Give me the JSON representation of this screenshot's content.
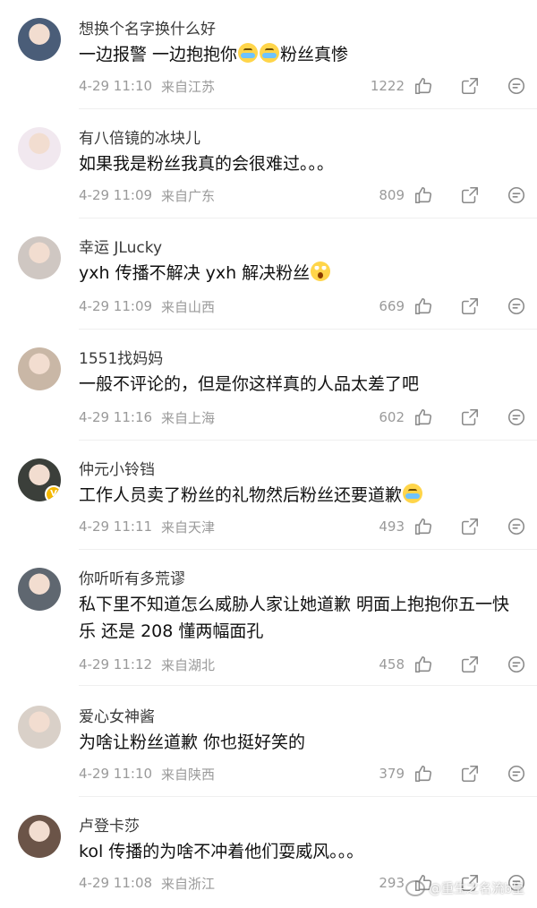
{
  "comments": [
    {
      "username": "想换个名字换什么好",
      "text_parts": [
        "一边报警 一边抱抱你",
        "",
        "粉丝真惨"
      ],
      "emojis": [
        "cry",
        "cry"
      ],
      "date": "4-29 11:10",
      "location": "来自江苏",
      "likes": "1222",
      "avatar_color": "#4a5d78"
    },
    {
      "username": "有八倍镜的冰块儿",
      "text_parts": [
        "如果我是粉丝我真的会很难过。。。"
      ],
      "emojis": [],
      "date": "4-29 11:09",
      "location": "来自广东",
      "likes": "809",
      "avatar_color": "#f1e8ef"
    },
    {
      "username": "幸运 JLucky",
      "text_parts": [
        "yxh 传播不解决 yxh 解决粉丝"
      ],
      "emojis": [
        "shock"
      ],
      "date": "4-29 11:09",
      "location": "来自山西",
      "likes": "669",
      "avatar_color": "#cfc7c2"
    },
    {
      "username": "1551找妈妈",
      "text_parts": [
        "一般不评论的，但是你这样真的人品太差了吧"
      ],
      "emojis": [],
      "date": "4-29 11:16",
      "location": "来自上海",
      "likes": "602",
      "avatar_color": "#c9b7a6"
    },
    {
      "username": "仲元小铃铛",
      "text_parts": [
        "工作人员卖了粉丝的礼物然后粉丝还要道歉"
      ],
      "emojis": [
        "cry"
      ],
      "date": "4-29 11:11",
      "location": "来自天津",
      "likes": "493",
      "avatar_color": "#3b3f3a",
      "verified": true,
      "badge": "V"
    },
    {
      "username": "你听听有多荒谬",
      "text_parts": [
        "私下里不知道怎么威胁人家让她道歉 明面上抱抱你五一快乐 还是 208 懂两幅面孔"
      ],
      "emojis": [],
      "date": "4-29 11:12",
      "location": "来自湖北",
      "likes": "458",
      "avatar_color": "#5f6770"
    },
    {
      "username": "爱心女神酱",
      "text_parts": [
        "为啥让粉丝道歉 你也挺好笑的"
      ],
      "emojis": [],
      "date": "4-29 11:10",
      "location": "来自陕西",
      "likes": "379",
      "avatar_color": "#d9d0c8"
    },
    {
      "username": "卢登卡莎",
      "text_parts": [
        "kol 传播的为啥不冲着他们耍威风。。。"
      ],
      "emojis": [],
      "date": "4-29 11:08",
      "location": "来自浙江",
      "likes": "293",
      "avatar_color": "#6b5448"
    }
  ],
  "icons": {
    "like": "thumbs-up-icon",
    "share": "share-icon",
    "reply": "comment-icon"
  },
  "watermark": {
    "text": "@重生之名流b皇"
  },
  "colors": {
    "meta_text": "#9a9a9a",
    "divider": "#efefef",
    "verified_badge": "#f5b800"
  }
}
